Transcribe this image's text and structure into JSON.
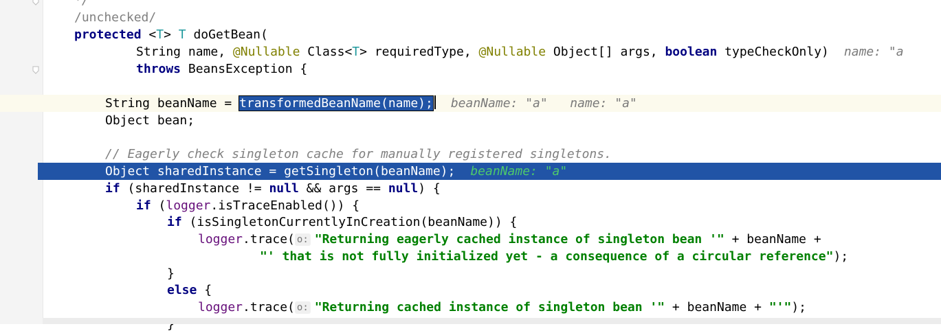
{
  "editor": {
    "lines": [
      {
        "tokens": [
          {
            "t": "*/",
            "c": "cmt"
          }
        ]
      },
      {
        "tokens": [
          {
            "t": "/unchecked/",
            "c": "cmt-plain"
          }
        ]
      },
      {
        "tokens": [
          {
            "t": "protected",
            "c": "kw"
          },
          {
            "t": " <",
            "c": ""
          },
          {
            "t": "T",
            "c": "tp"
          },
          {
            "t": "> ",
            "c": ""
          },
          {
            "t": "T",
            "c": "tp"
          },
          {
            "t": " doGetBean(",
            "c": ""
          }
        ]
      },
      {
        "tokens": [
          {
            "t": "String name, ",
            "c": ""
          },
          {
            "t": "@Nullable",
            "c": "ann"
          },
          {
            "t": " Class<",
            "c": ""
          },
          {
            "t": "T",
            "c": "tp"
          },
          {
            "t": "> requiredType, ",
            "c": ""
          },
          {
            "t": "@Nullable",
            "c": "ann"
          },
          {
            "t": " Object[] args, ",
            "c": ""
          },
          {
            "t": "boolean",
            "c": "kw"
          },
          {
            "t": " typeCheckOnly)",
            "c": ""
          }
        ],
        "hint": "name: \"a\""
      },
      {
        "tokens": [
          {
            "t": "throws",
            "c": "kw"
          },
          {
            "t": " BeansException {",
            "c": ""
          }
        ]
      },
      {
        "tokens": []
      },
      {
        "tokens": [
          {
            "t": "String beanName = ",
            "c": ""
          },
          {
            "t": "transformedBeanName(name);",
            "c": "sel"
          }
        ],
        "hint": "beanName: \"a\"   name: \"a\""
      },
      {
        "tokens": [
          {
            "t": "Object bean;",
            "c": ""
          }
        ]
      },
      {
        "tokens": []
      },
      {
        "tokens": [
          {
            "t": "// Eagerly check singleton cache for manually registered singletons.",
            "c": "cmt"
          }
        ]
      },
      {
        "tokens": [
          {
            "t": "Object sharedInstance = getSingleton(beanName);",
            "c": ""
          }
        ],
        "hint": "beanName: \"a\""
      },
      {
        "tokens": [
          {
            "t": "if",
            "c": "kw"
          },
          {
            "t": " (sharedInstance != ",
            "c": ""
          },
          {
            "t": "null",
            "c": "kw"
          },
          {
            "t": " && args == ",
            "c": ""
          },
          {
            "t": "null",
            "c": "kw"
          },
          {
            "t": ") {",
            "c": ""
          }
        ]
      },
      {
        "tokens": [
          {
            "t": "if",
            "c": "kw"
          },
          {
            "t": " (",
            "c": ""
          },
          {
            "t": "logger",
            "c": "fld"
          },
          {
            "t": ".isTraceEnabled()) {",
            "c": ""
          }
        ]
      },
      {
        "tokens": [
          {
            "t": "if",
            "c": "kw"
          },
          {
            "t": " (isSingletonCurrentlyInCreation(beanName)) {",
            "c": ""
          }
        ]
      },
      {
        "tokens": [
          {
            "t": "logger",
            "c": "fld"
          },
          {
            "t": ".trace(",
            "c": ""
          },
          {
            "t": "o:",
            "c": "param"
          },
          {
            "t": "\"Returning eagerly cached instance of singleton bean '\"",
            "c": "str"
          },
          {
            "t": " + beanName +",
            "c": ""
          }
        ]
      },
      {
        "tokens": [
          {
            "t": "\"' that is not fully initialized yet - a consequence of a circular reference\"",
            "c": "str"
          },
          {
            "t": ");",
            "c": ""
          }
        ]
      },
      {
        "tokens": [
          {
            "t": "}",
            "c": ""
          }
        ]
      },
      {
        "tokens": [
          {
            "t": "else",
            "c": "kw"
          },
          {
            "t": " {",
            "c": ""
          }
        ]
      },
      {
        "tokens": [
          {
            "t": "logger",
            "c": "fld"
          },
          {
            "t": ".trace(",
            "c": ""
          },
          {
            "t": "o:",
            "c": "param"
          },
          {
            "t": "\"Returning cached instance of singleton bean '\"",
            "c": "str"
          },
          {
            "t": " + beanName + ",
            "c": ""
          },
          {
            "t": "\"'\"",
            "c": "str"
          },
          {
            "t": ");",
            "c": ""
          }
        ]
      },
      {
        "tokens": [
          {
            "t": "}",
            "c": ""
          }
        ]
      }
    ],
    "truncated_hint": "name: \"a"
  }
}
